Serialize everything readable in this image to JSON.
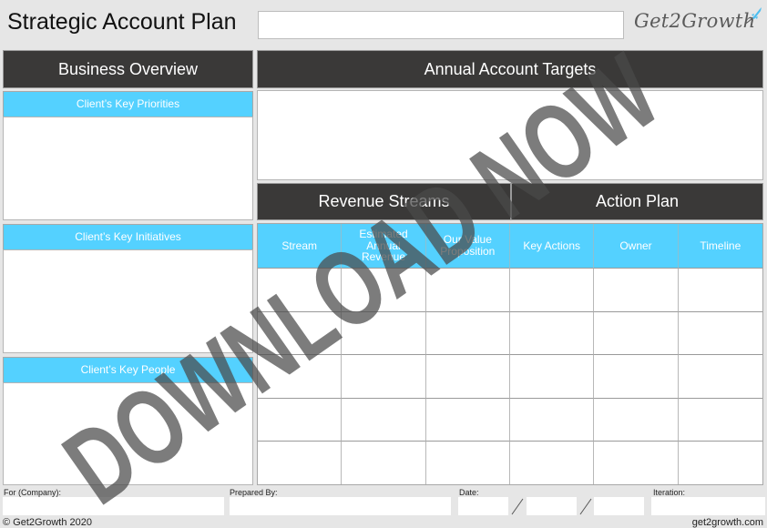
{
  "header": {
    "title": "Strategic Account Plan",
    "title_input_value": "",
    "logo_text": "Get2Growth",
    "logo_icon": "rocket-icon"
  },
  "business_overview": {
    "title": "Business Overview",
    "sections": [
      {
        "label": "Client’s Key Priorities",
        "value": ""
      },
      {
        "label": "Client’s Key Initiatives",
        "value": ""
      },
      {
        "label": "Client’s Key People",
        "value": ""
      }
    ]
  },
  "annual_targets": {
    "title": "Annual Account Targets",
    "value": ""
  },
  "revenue_streams": {
    "title": "Revenue Streams",
    "columns": [
      "Stream",
      "Estimated Annual Revenue",
      "Our Value Proposition"
    ]
  },
  "action_plan": {
    "title": "Action Plan",
    "columns": [
      "Key Actions",
      "Owner",
      "Timeline"
    ]
  },
  "table": {
    "rows": [
      [
        "",
        "",
        "",
        "",
        "",
        ""
      ],
      [
        "",
        "",
        "",
        "",
        "",
        ""
      ],
      [
        "",
        "",
        "",
        "",
        "",
        ""
      ],
      [
        "",
        "",
        "",
        "",
        "",
        ""
      ],
      [
        "",
        "",
        "",
        "",
        "",
        ""
      ]
    ]
  },
  "footer_fields": {
    "for_company_label": "For (Company):",
    "for_company_value": "",
    "prepared_by_label": "Prepared By:",
    "prepared_by_value": "",
    "date_label": "Date:",
    "date_day": "",
    "date_month": "",
    "date_year": "",
    "iteration_label": "Iteration:",
    "iteration_value": ""
  },
  "footer": {
    "copyright": "© Get2Growth 2020",
    "website": "get2growth.com"
  },
  "watermark": {
    "text": "DOWNLOAD NOW"
  },
  "colors": {
    "dark_header": "#3a3938",
    "blue_header": "#54d1ff",
    "page_bg": "#e6e6e6",
    "watermark": "#5a5a5a"
  }
}
